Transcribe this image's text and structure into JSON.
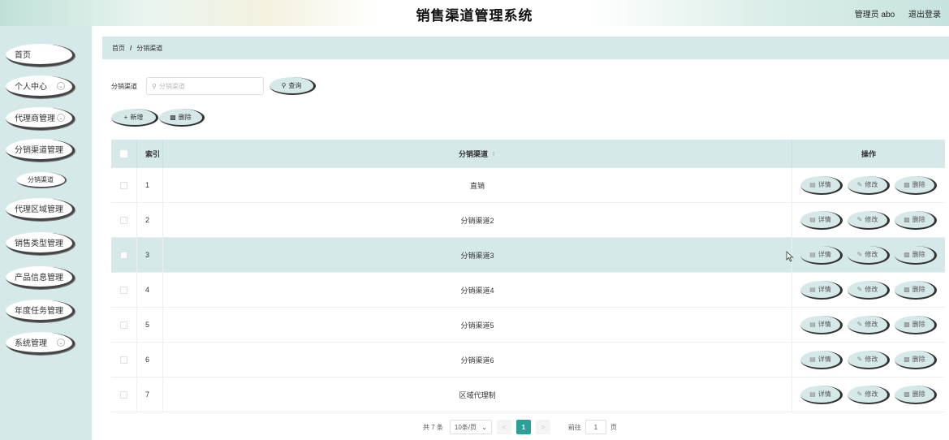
{
  "header": {
    "title": "销售渠道管理系统",
    "user": "管理员 abo",
    "logout": "退出登录"
  },
  "sidebar": {
    "items": [
      {
        "label": "首页",
        "has_chevron": false
      },
      {
        "label": "个人中心",
        "has_chevron": true
      },
      {
        "label": "代理商管理",
        "has_chevron": true
      },
      {
        "label": "分销渠道管理",
        "has_chevron": false
      },
      {
        "label": "代理区域管理",
        "has_chevron": false
      },
      {
        "label": "销售类型管理",
        "has_chevron": false
      },
      {
        "label": "产品信息管理",
        "has_chevron": false
      },
      {
        "label": "年度任务管理",
        "has_chevron": false
      },
      {
        "label": "系统管理",
        "has_chevron": true
      }
    ],
    "sub_item": "分销渠道",
    "chevron_glyph": "⌄"
  },
  "breadcrumb": {
    "home": "首页",
    "sep": "/",
    "current": "分销渠道"
  },
  "search": {
    "label": "分销渠道",
    "placeholder": "分销渠道",
    "button": "查询",
    "search_icon": "search-icon"
  },
  "toolbar": {
    "add": "新增",
    "delete": "删除"
  },
  "table": {
    "headers": {
      "index": "索引",
      "name": "分销渠道",
      "ops": "操作"
    },
    "sort_glyph": "⇕",
    "rows": [
      {
        "index": "1",
        "name": "直销"
      },
      {
        "index": "2",
        "name": "分销渠道2"
      },
      {
        "index": "3",
        "name": "分销渠道3"
      },
      {
        "index": "4",
        "name": "分销渠道4"
      },
      {
        "index": "5",
        "name": "分销渠道5"
      },
      {
        "index": "6",
        "name": "分销渠道6"
      },
      {
        "index": "7",
        "name": "区域代理制"
      }
    ],
    "highlighted_row": 3,
    "ops": {
      "detail": "详情",
      "edit": "修改",
      "delete": "删除"
    }
  },
  "pagination": {
    "total": "共 7 条",
    "page_size": "10条/页",
    "prev": "<",
    "current": "1",
    "next": ">",
    "goto_prefix": "前往",
    "goto_value": "1",
    "goto_suffix": "页",
    "dropdown_glyph": "⌄"
  },
  "colors": {
    "accent": "#2aa198",
    "panel": "#d6e9e9"
  }
}
